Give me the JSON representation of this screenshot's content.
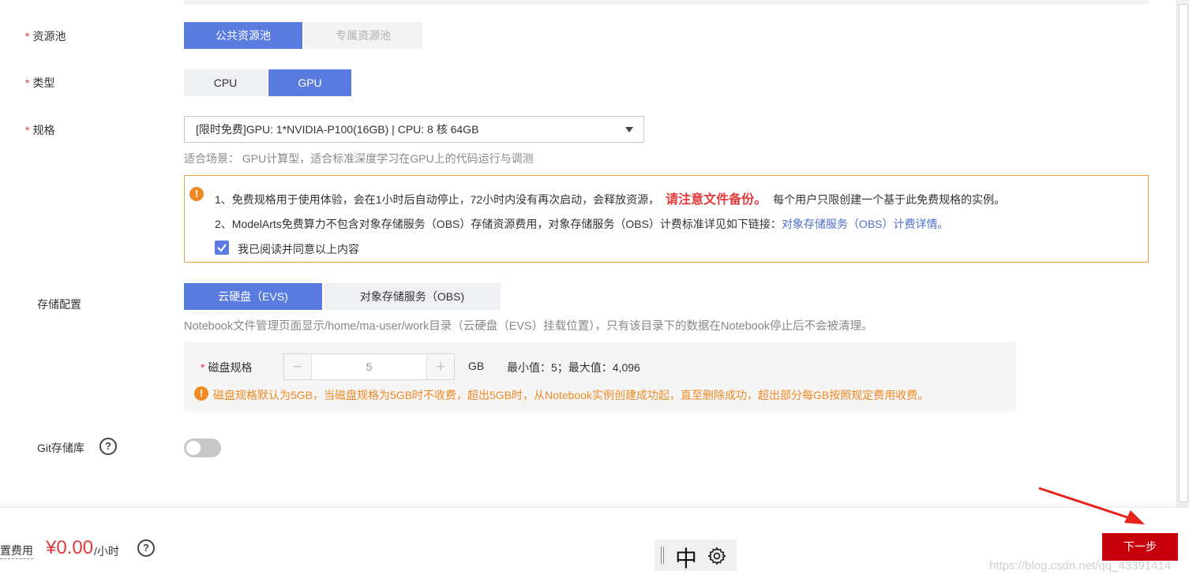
{
  "form": {
    "resource_pool": {
      "label": "资源池",
      "options": [
        "公共资源池",
        "专属资源池"
      ],
      "selected": "公共资源池"
    },
    "type": {
      "label": "类型",
      "options": [
        "CPU",
        "GPU"
      ],
      "selected": "GPU"
    },
    "spec": {
      "label": "规格",
      "value": "[限时免费]GPU: 1*NVIDIA-P100(16GB) | CPU: 8 核 64GB",
      "hint": "适合场景： GPU计算型，适合标准深度学习在GPU上的代码运行与调测"
    },
    "notice": {
      "line1_a": "1、免费规格用于使用体验，会在1小时后自动停止，72小时内没有再次启动，会释放资源，",
      "line1_strong": "请注意文件备份。",
      "line1_b": "每个用户只限创建一个基于此免费规格的实例。",
      "line2_a": "2、ModelArts免费算力不包含对象存储服务（OBS）存储资源费用，对象存储服务（OBS）计费标准详见如下链接：",
      "line2_link": "对象存储服务（OBS）计费详情。",
      "agree_label": "我已阅读并同意以上内容",
      "agree_checked": true
    },
    "storage": {
      "label": "存储配置",
      "options": [
        "云硬盘（EVS)",
        "对象存储服务（OBS)"
      ],
      "selected": "云硬盘（EVS)",
      "hint": "Notebook文件管理页面显示/home/ma-user/work目录（云硬盘（EVS）挂载位置），只有该目录下的数据在Notebook停止后不会被清理。",
      "disk": {
        "label": "磁盘规格",
        "minus": "−",
        "plus": "+",
        "value": "5",
        "unit": "GB",
        "range": "最小值：5；最大值：4,096",
        "warning": "磁盘规格默认为5GB，当磁盘规格为5GB时不收费，超出5GB时，从Notebook实例创建成功起，直至删除成功，超出部分每GB按照规定费用收费。"
      }
    },
    "git": {
      "label": "Git存储库",
      "help": "?",
      "enabled": false
    }
  },
  "footer": {
    "cost_label": "配置费用",
    "price": "¥0.00",
    "unit": "/小时",
    "help": "?",
    "ime_char": "中",
    "next_button": "下一步",
    "watermark": "https://blog.csdn.net/qq_43391414"
  },
  "colors": {
    "primary": "#5a7bdf",
    "danger": "#e4393c",
    "warning": "#f08a24",
    "next_button": "#c7000b"
  }
}
